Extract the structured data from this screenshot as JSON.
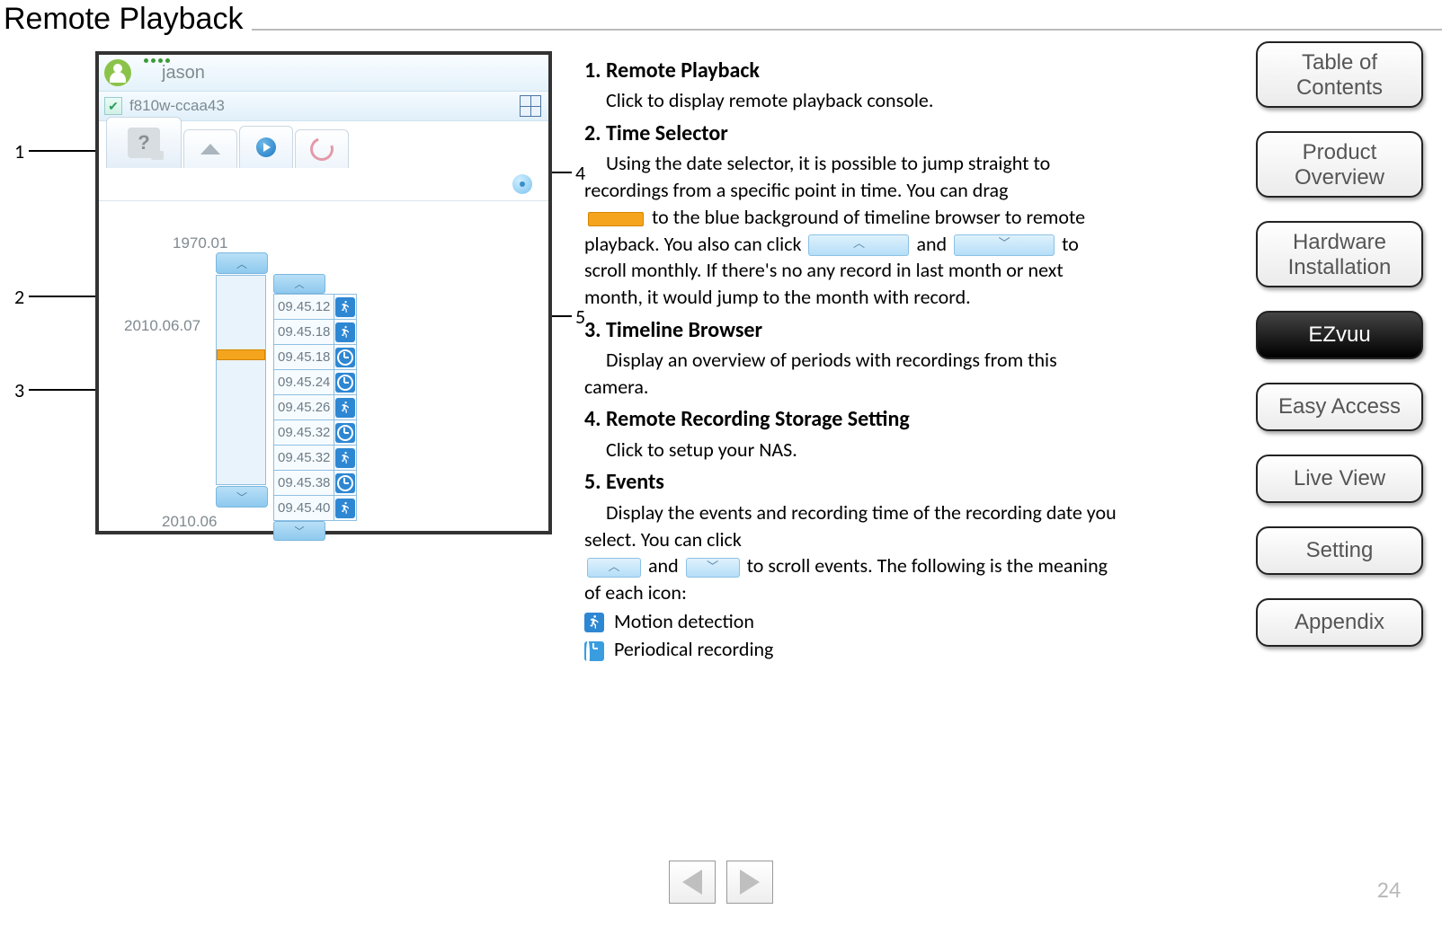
{
  "title": "Remote Playback",
  "page_number": "24",
  "nav": {
    "toc": "Table of\nContents",
    "product": "Product\nOverview",
    "hardware": "Hardware\nInstallation",
    "ezvuu": "EZvuu",
    "easy": "Easy Access",
    "live": "Live View",
    "setting": "Setting",
    "appendix": "Appendix"
  },
  "mock": {
    "username": "jason",
    "camera_id": "f810w-ccaa43",
    "top_date": "1970.01",
    "sel_date": "2010.06.07",
    "bottom_date": "2010.06",
    "events": [
      {
        "t": "09.45.12",
        "type": "motion"
      },
      {
        "t": "09.45.18",
        "type": "motion"
      },
      {
        "t": "09.45.18",
        "type": "periodic"
      },
      {
        "t": "09.45.24",
        "type": "periodic"
      },
      {
        "t": "09.45.26",
        "type": "motion"
      },
      {
        "t": "09.45.32",
        "type": "periodic"
      },
      {
        "t": "09.45.32",
        "type": "motion"
      },
      {
        "t": "09.45.38",
        "type": "periodic"
      },
      {
        "t": "09.45.40",
        "type": "motion"
      }
    ],
    "callouts": [
      "1",
      "2",
      "3",
      "4",
      "5"
    ]
  },
  "body": {
    "s1h": "1. Remote Playback",
    "s1p": "Click to display remote playback console.",
    "s2h": "2. Time Selector",
    "s2p1": "Using the date selector, it is possible to jump straight to recordings from a specific point in time. You can drag ",
    "s2p2": " to the blue background of timeline browser to remote playback. You also can click ",
    "s2and": " and ",
    "s2p3": " to scroll monthly. If there's no any record in last month or next month, it would jump to the month with record.",
    "s3h": "3. Timeline Browser",
    "s3p": "Display an overview of periods with recordings from this camera.",
    "s4h": "4. Remote Recording Storage Setting",
    "s4p": "Click to setup your NAS.",
    "s5h": "5. Events",
    "s5p1": "Display the events and recording time of the recording date you select. You can click ",
    "s5p2": " and ",
    "s5p3": " to scroll events. The following is the meaning of each icon:",
    "icon_motion": "Motion detection",
    "icon_periodic": "Periodical recording"
  }
}
